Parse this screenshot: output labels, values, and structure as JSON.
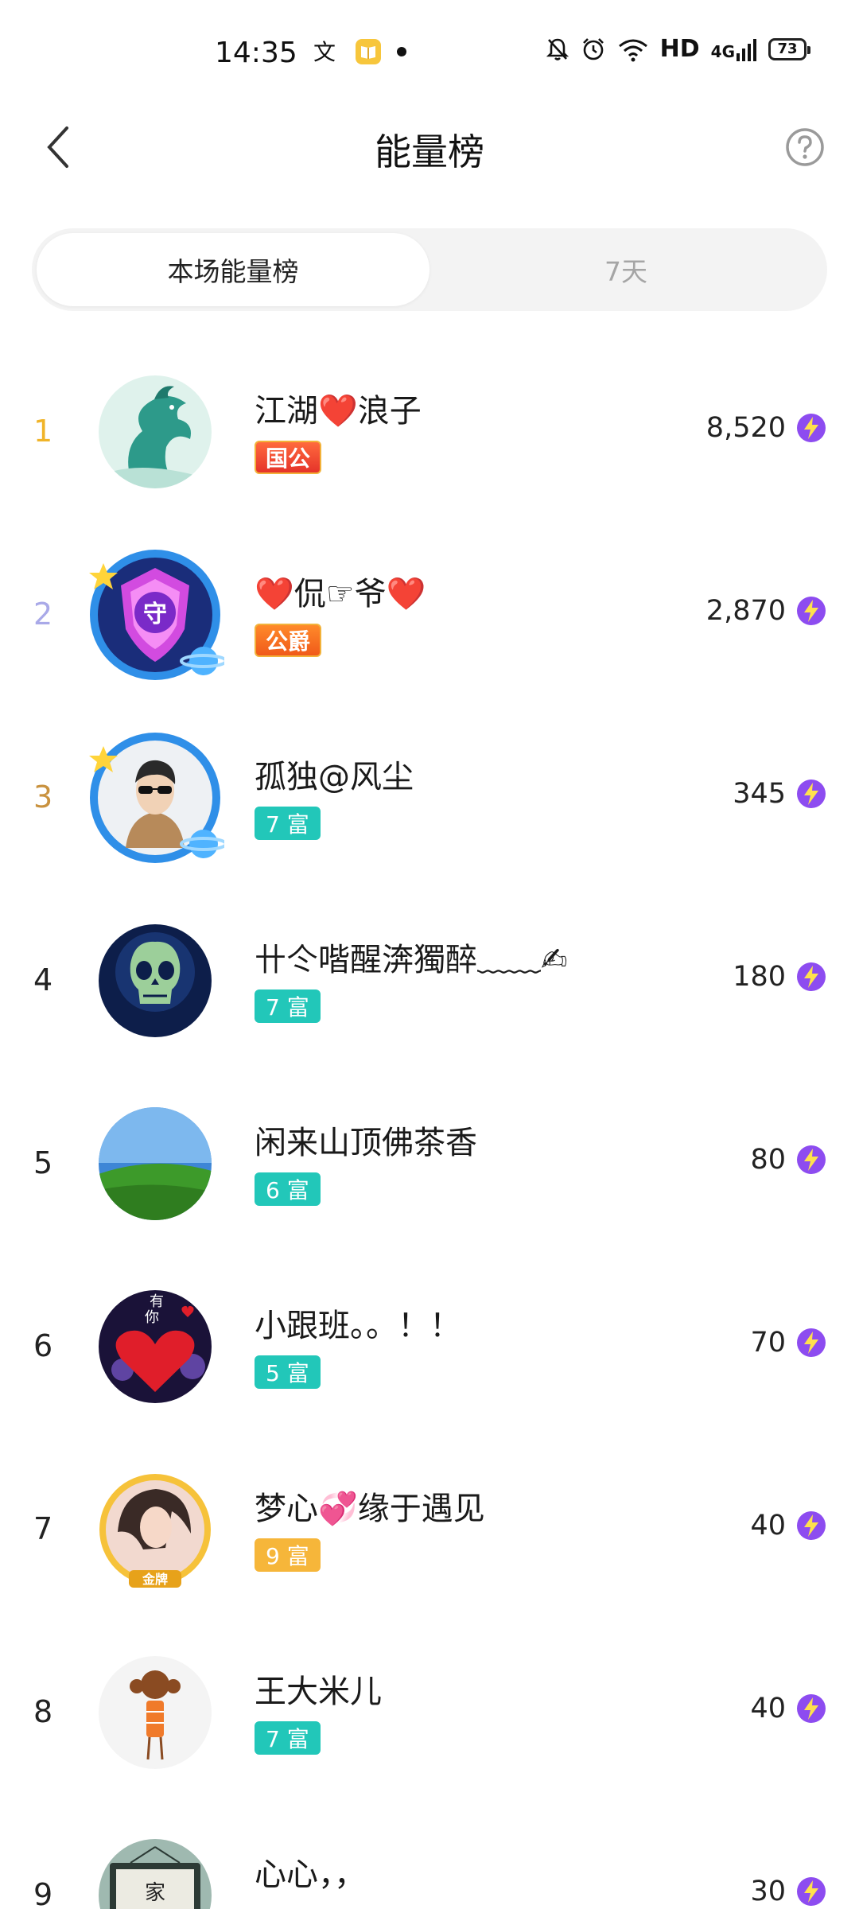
{
  "status": {
    "time": "14:35",
    "network": "HD",
    "network_gen": "4G",
    "battery": "73"
  },
  "header": {
    "title": "能量榜"
  },
  "tabs": [
    {
      "label": "本场能量榜",
      "active": true
    },
    {
      "label": "7天",
      "active": false
    }
  ],
  "colors": {
    "rank1": "#f0b429",
    "rank2": "#a9a9e8",
    "rank3": "#c9923f",
    "teal_badge": "#22c7b9",
    "gold_badge": "#f6b63a",
    "energy_icon": "#8d4cf0"
  },
  "ranking": [
    {
      "rank": "1",
      "name": "江湖❤️浪子",
      "badge": "国公",
      "score": "8,520"
    },
    {
      "rank": "2",
      "name": "❤️侃☞爷❤️",
      "badge": "公爵",
      "score": "2,870"
    },
    {
      "rank": "3",
      "name": "孤独@风尘",
      "badge": "7 富",
      "score": "345"
    },
    {
      "rank": "4",
      "name": "卄仒喈醒渀獨醉﹏﹏✍",
      "badge": "7 富",
      "score": "180"
    },
    {
      "rank": "5",
      "name": "闲来山顶佛茶香",
      "badge": "6 富",
      "score": "80"
    },
    {
      "rank": "6",
      "name": "小跟班。。！！",
      "badge": "5 富",
      "score": "70"
    },
    {
      "rank": "7",
      "name": "梦心💞缘于遇见",
      "badge": "9 富",
      "score": "40"
    },
    {
      "rank": "8",
      "name": "王大米儿",
      "badge": "7 富",
      "score": "40"
    },
    {
      "rank": "9",
      "name": "心心，，",
      "badge": "",
      "score": "30"
    }
  ],
  "avatar_texts": {
    "guard_frame": "守",
    "avatar6_top": "有",
    "avatar6_bottom": "你",
    "avatar7_plate": "金牌",
    "avatar9_sign": "家"
  }
}
